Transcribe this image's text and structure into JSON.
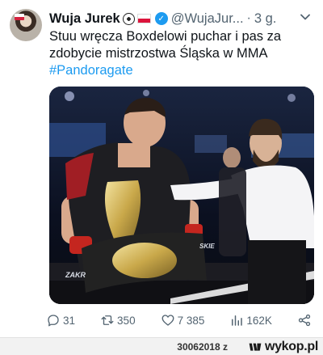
{
  "tweet": {
    "author_name": "Wuja Jurek",
    "handle": "@WujaJur...",
    "separator": "·",
    "time": "3 g.",
    "text_line1": "Stuu wręcza Boxdelowi puchar i pas za",
    "text_line2": "zdobycie mistrzostwa Śląska w MMA",
    "hashtag": "#Pandoragate",
    "media_overlay_text": "SKIE",
    "media_overlay_text2": "ZAKR"
  },
  "actions": {
    "replies": "31",
    "retweets": "350",
    "likes": "7 385",
    "views": "162K"
  },
  "footer": {
    "text": "30062018 z",
    "site": "wykop.pl"
  },
  "colors": {
    "link": "#1d9bf0",
    "secondary_text": "#536471",
    "verified": "#1d9bf0"
  }
}
